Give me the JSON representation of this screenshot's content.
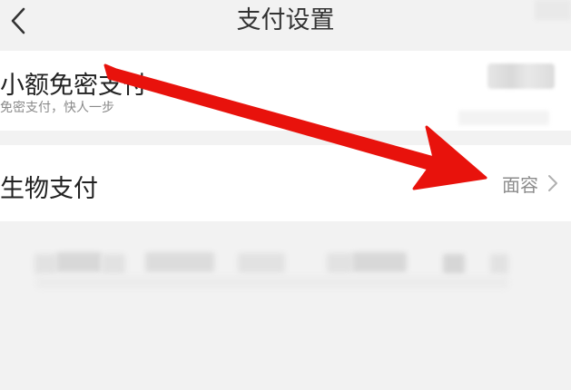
{
  "header": {
    "title": "支付设置",
    "back_icon": "chevron-left-icon"
  },
  "settings": [
    {
      "title": "小额免密支付",
      "subtitle": "免密支付，快人一步",
      "control": "blurred-toggle"
    },
    {
      "title": "生物支付",
      "value": "面容",
      "icon": "chevron-right-icon"
    }
  ],
  "annotation": {
    "arrow_color": "#e8120c"
  }
}
